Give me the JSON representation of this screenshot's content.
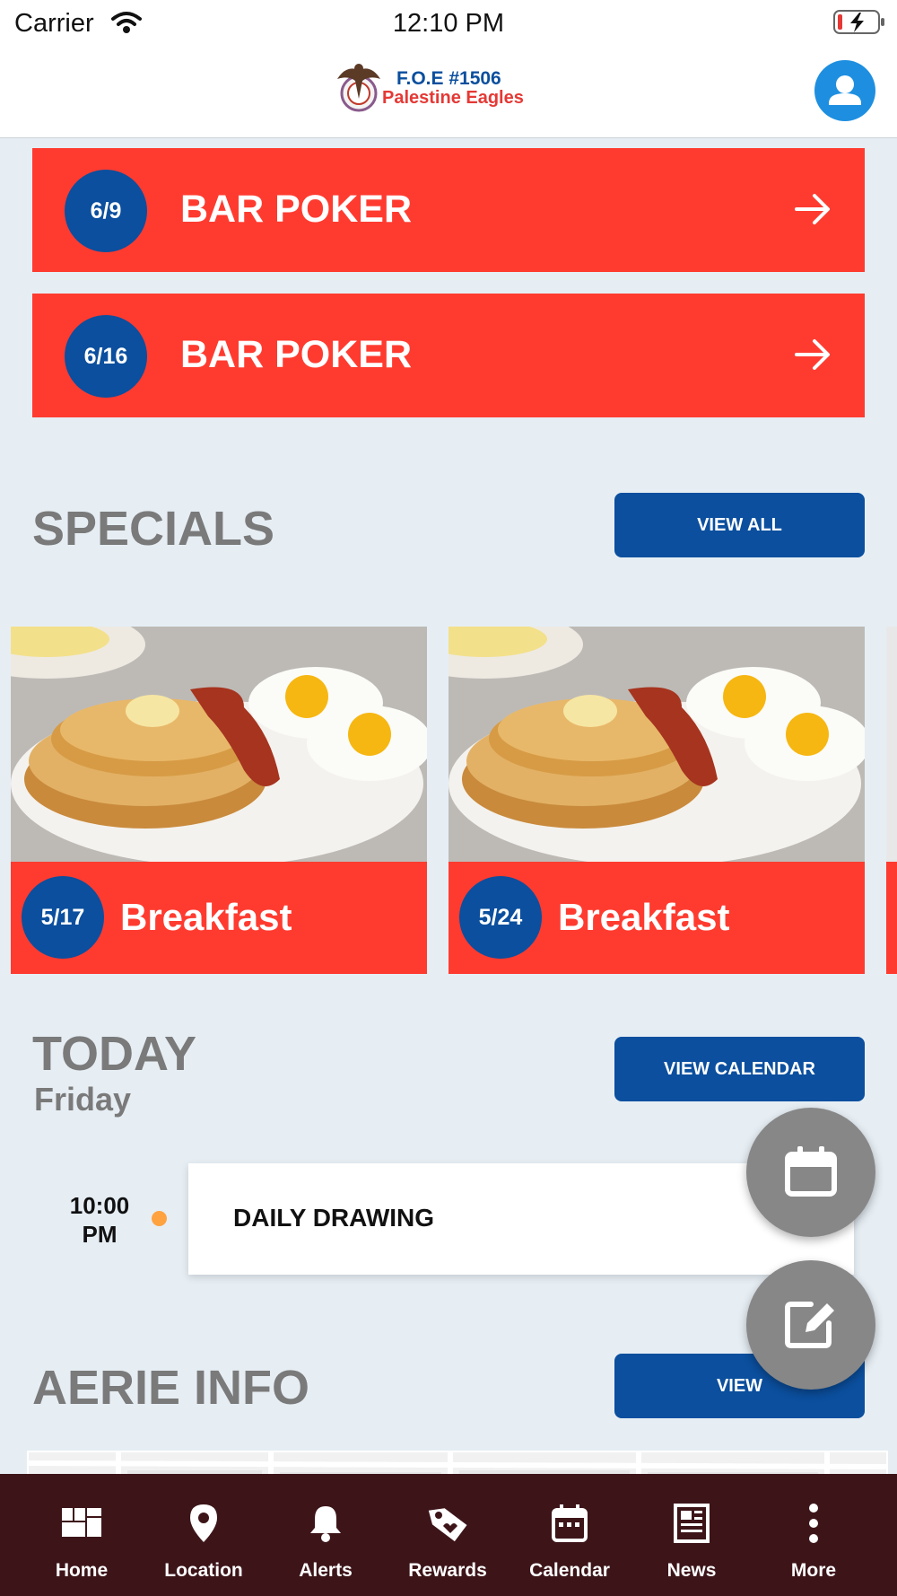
{
  "status_bar": {
    "carrier": "Carrier",
    "time": "12:10 PM"
  },
  "header": {
    "logo_line1": "F.O.E #1506",
    "logo_line2": "Palestine Eagles"
  },
  "events": [
    {
      "date": "6/9",
      "title": "BAR POKER"
    },
    {
      "date": "6/16",
      "title": "BAR POKER"
    }
  ],
  "specials": {
    "title": "SPECIALS",
    "button": "VIEW ALL",
    "items": [
      {
        "date": "5/17",
        "name": "Breakfast"
      },
      {
        "date": "5/24",
        "name": "Breakfast"
      }
    ]
  },
  "today": {
    "title": "TODAY",
    "day": "Friday",
    "button": "VIEW CALENDAR",
    "items": [
      {
        "time_line1": "10:00",
        "time_line2": "PM",
        "title": "DAILY DRAWING"
      }
    ]
  },
  "aerie": {
    "title": "AERIE INFO",
    "button": "VIEW"
  },
  "tabs": [
    {
      "label": "Home",
      "icon": "dashboard-icon"
    },
    {
      "label": "Location",
      "icon": "location-pin-icon"
    },
    {
      "label": "Alerts",
      "icon": "bell-icon"
    },
    {
      "label": "Rewards",
      "icon": "tag-icon"
    },
    {
      "label": "Calendar",
      "icon": "calendar-icon"
    },
    {
      "label": "News",
      "icon": "newspaper-icon"
    },
    {
      "label": "More",
      "icon": "more-vertical-icon"
    }
  ],
  "colors": {
    "accent_red": "#ff3b30",
    "brand_blue": "#0b4f9e",
    "tabbar": "#3d1519",
    "background": "#e6eef4"
  }
}
